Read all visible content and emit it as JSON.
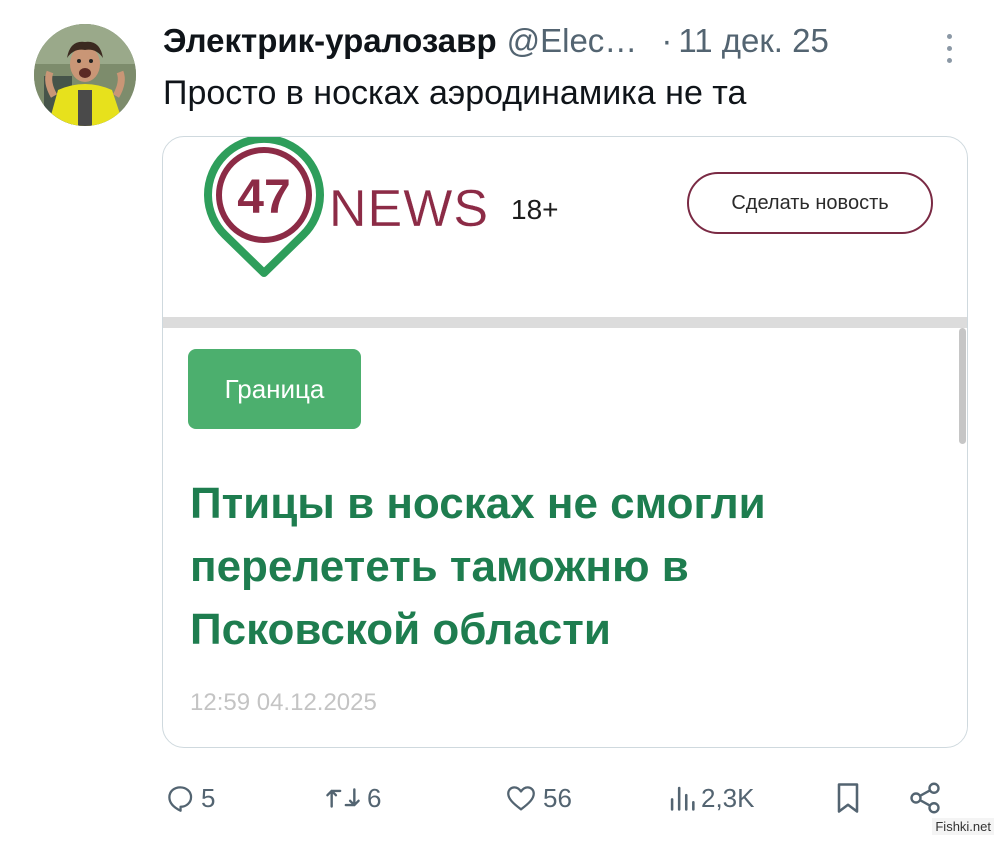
{
  "post": {
    "author_name": "Электрик-уралозавр",
    "handle": "@Elec…",
    "separator": "·",
    "date": "11 дек. 25",
    "text": "Просто в носках аэродинамика не та"
  },
  "card": {
    "logo_number": "47",
    "logo_word": "NEWS",
    "age_rating": "18+",
    "make_news_button": "Сделать новость",
    "category_tag": "Граница",
    "headline": "Птицы в носках не смогли перелететь таможню в Псковской области",
    "datetime": "12:59 04.12.2025"
  },
  "actions": {
    "replies": "5",
    "reposts": "6",
    "likes": "56",
    "views": "2,3K"
  },
  "watermark": "Fishki.net",
  "colors": {
    "brand_maroon": "#8c2b46",
    "pin_green": "#2e9e5b",
    "headline_green": "#1e7d4f",
    "tag_green": "#4caf6e",
    "muted": "#536471"
  }
}
